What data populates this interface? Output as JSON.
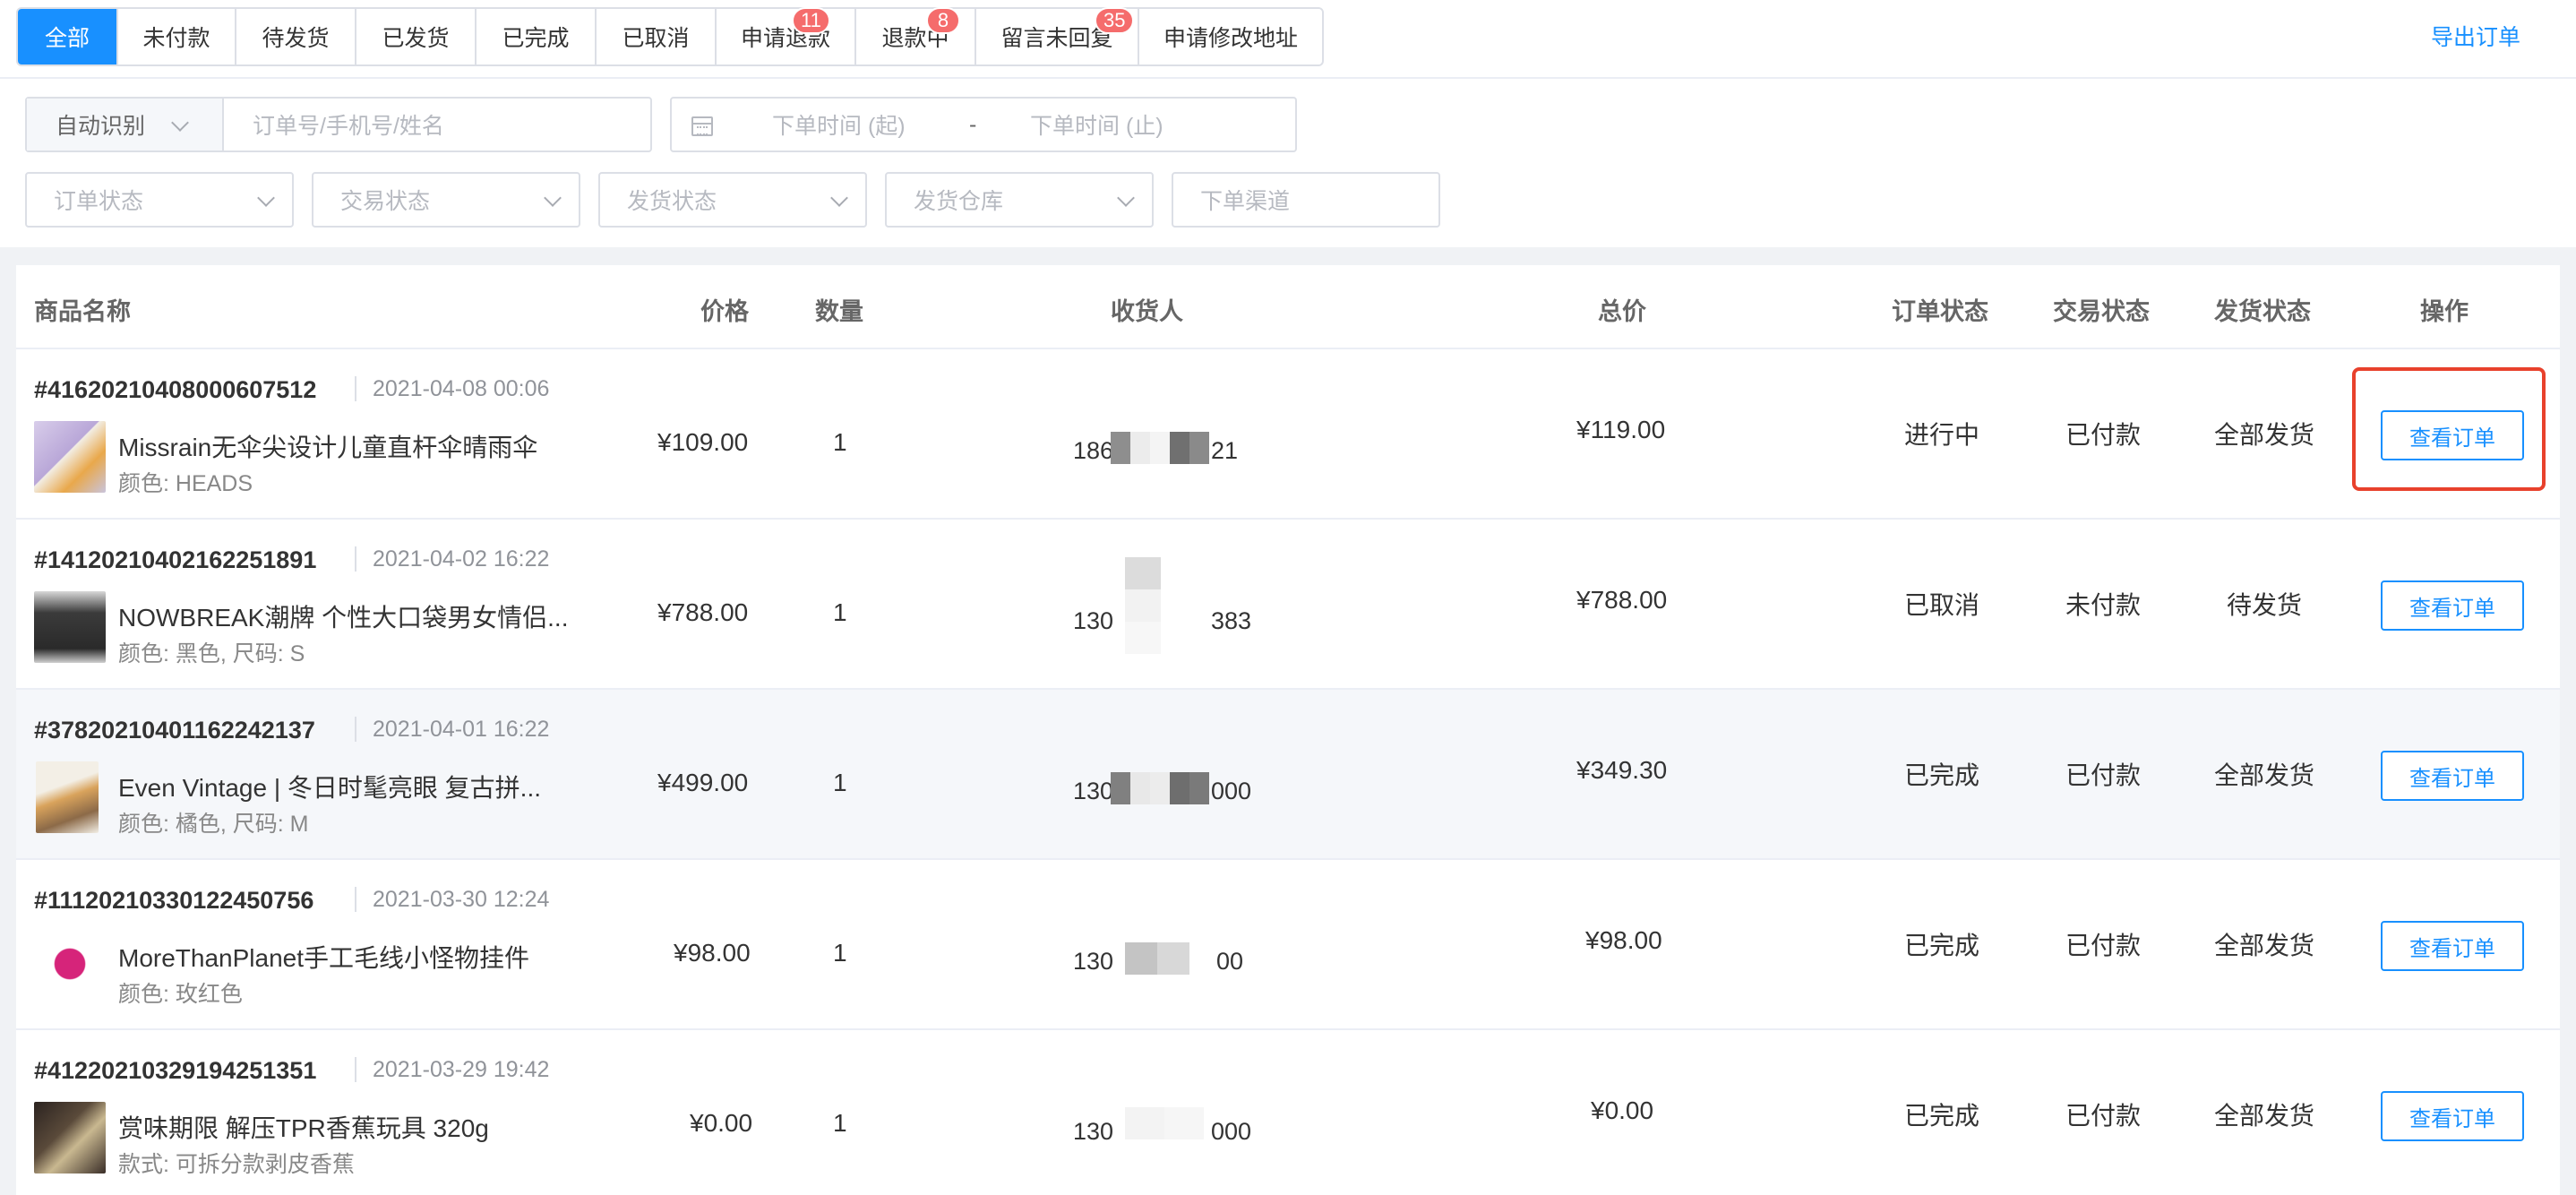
{
  "tabs": [
    {
      "label": "全部",
      "active": true
    },
    {
      "label": "未付款"
    },
    {
      "label": "待发货"
    },
    {
      "label": "已发货"
    },
    {
      "label": "已完成"
    },
    {
      "label": "已取消"
    },
    {
      "label": "申请退款",
      "badge": "11"
    },
    {
      "label": "退款中",
      "badge": "8"
    },
    {
      "label": "留言未回复",
      "badge": "35"
    },
    {
      "label": "申请修改地址"
    }
  ],
  "export_label": "导出订单",
  "filters": {
    "auto_detect": "自动识别",
    "search_placeholder": "订单号/手机号/姓名",
    "date_start": "下单时间 (起)",
    "date_sep": "-",
    "date_end": "下单时间 (止)",
    "order_status": "订单状态",
    "trade_status": "交易状态",
    "ship_status": "发货状态",
    "warehouse": "发货仓库",
    "channel": "下单渠道"
  },
  "columns": {
    "product": "商品名称",
    "price": "价格",
    "qty": "数量",
    "receiver": "收货人",
    "total": "总价",
    "order_status": "订单状态",
    "trade_status": "交易状态",
    "ship_status": "发货状态",
    "action": "操作"
  },
  "orders": [
    {
      "order_no": "#4162021040800060 7512",
      "time": "2021-04-08 00:06",
      "name": "Missrain无伞尖设计儿童直杆伞晴雨伞",
      "spec": "颜色: HEADS",
      "price": "¥109.00",
      "qty": "1",
      "phone_a": "186",
      "phone_b": "21",
      "total": "¥119.00",
      "order_status": "进行中",
      "trade_status": "已付款",
      "ship_status": "全部发货",
      "action": "查看订单",
      "thumb_color": "#b9a7d8"
    },
    {
      "order_no": "#1412021040216225 1891",
      "time": "2021-04-02 16:22",
      "name": "NOWBREAK潮牌 个性大口袋男女情侣...",
      "spec": "颜色: 黑色, 尺码: S",
      "price": "¥788.00",
      "qty": "1",
      "phone_a": "130",
      "phone_b": "383",
      "total": "¥788.00",
      "order_status": "已取消",
      "trade_status": "未付款",
      "ship_status": "待发货",
      "action": "查看订单",
      "thumb_color": "#3b3b3b"
    },
    {
      "order_no": "#3782021040116224 2137",
      "time": "2021-04-01 16:22",
      "name": "Even Vintage | 冬日时髦亮眼 复古拼...",
      "spec": "颜色: 橘色, 尺码: M",
      "price": "¥499.00",
      "qty": "1",
      "phone_a": "130",
      "phone_b": "000",
      "total": "¥349.30",
      "order_status": "已完成",
      "trade_status": "已付款",
      "ship_status": "全部发货",
      "action": "查看订单",
      "thumb_color": "#d9a35c"
    },
    {
      "order_no": "#1112021033012245 0756",
      "time": "2021-03-30 12:24",
      "name": "MoreThanPlanet手工毛线小怪物挂件",
      "spec": "颜色: 玫红色",
      "price": "¥98.00",
      "qty": "1",
      "phone_a": "130",
      "phone_b": "00",
      "total": "¥98.00",
      "order_status": "已完成",
      "trade_status": "已付款",
      "ship_status": "全部发货",
      "action": "查看订单",
      "thumb_color": "#d6247a"
    },
    {
      "order_no": "#4122021032919425 1351",
      "time": "2021-03-29 19:42",
      "name": "赏味期限 解压TPR香蕉玩具 320g",
      "spec": "款式: 可拆分款剥皮香蕉",
      "price": "¥0.00",
      "qty": "1",
      "phone_a": "130",
      "phone_b": "000",
      "total": "¥0.00",
      "order_status": "已完成",
      "trade_status": "已付款",
      "ship_status": "全部发货",
      "action": "查看订单",
      "thumb_color": "#5a4a3a"
    }
  ]
}
